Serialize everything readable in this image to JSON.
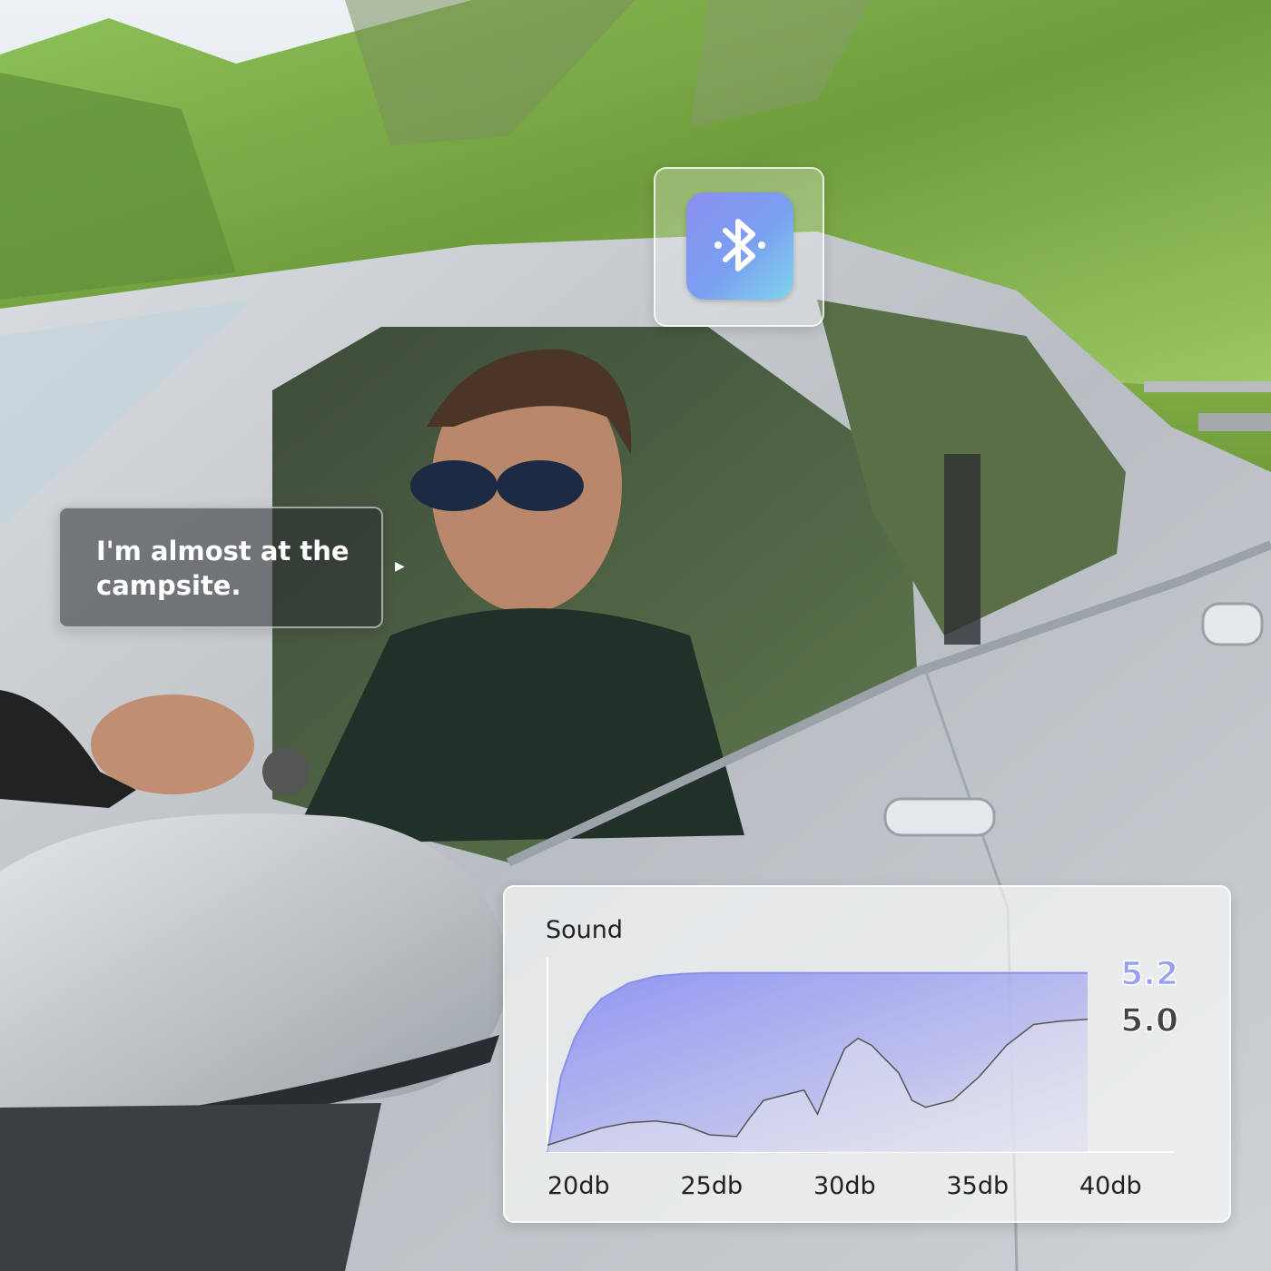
{
  "image": {
    "description_icons": [
      "bluetooth-icon",
      "play-arrow-icon"
    ],
    "accent_colors": {
      "bluetooth_gradient_start": "#8a8ff0",
      "bluetooth_gradient_end": "#7fd6ec",
      "series_primary": "#8890e8",
      "series_secondary": "#555555"
    }
  },
  "speech": {
    "text": "I'm almost at the campsite."
  },
  "chart_data": {
    "type": "area",
    "title": "Sound",
    "x_ticks": [
      "20db",
      "25db",
      "30db",
      "35db",
      "40db"
    ],
    "xlim": [
      20,
      40
    ],
    "ylim": [
      0,
      5.4
    ],
    "grid": false,
    "series": [
      {
        "label": "5.2",
        "color": "#8890e8",
        "x": [
          20,
          20.5,
          21,
          21.5,
          22,
          23,
          24,
          25,
          26,
          30,
          40
        ],
        "y": [
          0.0,
          2.2,
          3.3,
          4.0,
          4.45,
          4.9,
          5.1,
          5.17,
          5.2,
          5.2,
          5.2
        ]
      },
      {
        "label": "5.0",
        "color": "#555555",
        "x": [
          20,
          21,
          22,
          23,
          24,
          25,
          26,
          27,
          27.5,
          28,
          29,
          29.5,
          30,
          30.5,
          31,
          31.5,
          32,
          33,
          33.5,
          34,
          35,
          36,
          37,
          38,
          39,
          40
        ],
        "y": [
          0.2,
          0.45,
          0.7,
          0.85,
          0.9,
          0.8,
          0.5,
          0.45,
          1.0,
          1.5,
          1.7,
          1.8,
          1.1,
          2.1,
          3.0,
          3.3,
          3.1,
          2.3,
          1.5,
          1.3,
          1.5,
          2.2,
          3.1,
          3.7,
          3.8,
          3.85
        ]
      }
    ]
  }
}
